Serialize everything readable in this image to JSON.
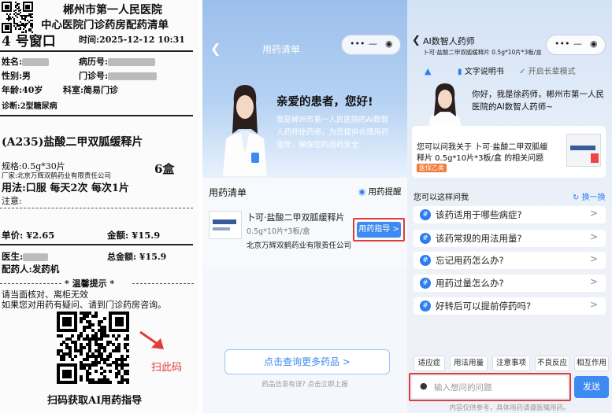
{
  "receipt": {
    "hospital": "郴州市第一人民医院",
    "subtitle": "中心医院门诊药房配药清单",
    "window": "4 号窗口",
    "time": "时间:2025-12-12 10:31",
    "name_label": "姓名:",
    "record_label": "病历号:",
    "sex": "性别:男",
    "clinic_label": "门诊号:",
    "age": "年龄:40岁",
    "dept": "科室:简易门诊",
    "diagnosis": "诊断:2型糖尿病",
    "drug": "(A235)盐酸二甲双胍缓释片",
    "spec": "规格:0.5g*30片",
    "maker": "厂家:北京万辉双鹤药业有限责任公司",
    "qty": "6盒",
    "usage": "用法:口服 每天2次 每次1片",
    "note": "注意:",
    "price": "单价: ¥2.65",
    "amount": "金额: ¥15.9",
    "doctor_label": "医生:",
    "total": "总金额: ¥15.9",
    "dispenser": "配药人:发药机",
    "tips_title": "* 温馨提示 *",
    "tip1": "请当面核对、离柜无效",
    "tip2": "如果您对用药有疑问、请到门诊药房咨询。",
    "scan_hint": "扫此码",
    "scan_caption": "扫码获取AI用药指导"
  },
  "panel2": {
    "nav_title": "用药清单",
    "capsule": [
      "•••",
      "—",
      "◉"
    ],
    "greeting": "亲爱的患者，您好!",
    "intro": [
      "我是郴州市第一人民医院的AI数智",
      "人药师徐药师，为您提供合理用药",
      "指导，确保您的用药安全"
    ],
    "list_title": "用药清单",
    "reminder": "用药提醒",
    "drug_name": "卜可·盐酸二甲双胍缓释片",
    "drug_spec": "0.5g*10片*3板/盒",
    "maker": "北京万辉双鹤药业有限责任公司",
    "guide_btn": "用药指导 >",
    "more_btn": "点击查询更多药品 >",
    "feedback": "药品信息有误? 点击立即上报"
  },
  "panel3": {
    "nav_title": "AI数智人药师",
    "nav_sub": "卜可·盐酸二甲双胍缓释片 0.5g*10片*3板/盒",
    "capsule": [
      "•••",
      "—",
      "◉"
    ],
    "manual_label": "文字说明书",
    "longterm_label": "开启长辈模式",
    "greeting": [
      "你好，我是徐药师，郴州市第一人民",
      "医院的AI数智人药师~"
    ],
    "ask_intro": [
      "您可以问我关于 卜可·盐酸二甲双胍缓",
      "释片 0.5g*10片*3板/盒 的相关问题"
    ],
    "insurance_badge": "医保乙类",
    "can_ask": "您可以这样问我",
    "refresh": "换一换",
    "questions": [
      "该药适用于哪些病症?",
      "该药常规的用法用量?",
      "忘记用药怎么办?",
      "用药过量怎么办?",
      "好转后可以提前停药吗?"
    ],
    "chips": [
      "适应症",
      "用法用量",
      "注意事项",
      "不良反应",
      "相互作用"
    ],
    "input_placeholder": "输入想问的问题",
    "send": "发送",
    "disclaimer": "内容仅供参考，具体用药请遵医嘱用药。"
  },
  "colors": {
    "accent": "#3d8bf0",
    "highlight_box": "#e23b3b",
    "badge": "#f07a3a"
  }
}
